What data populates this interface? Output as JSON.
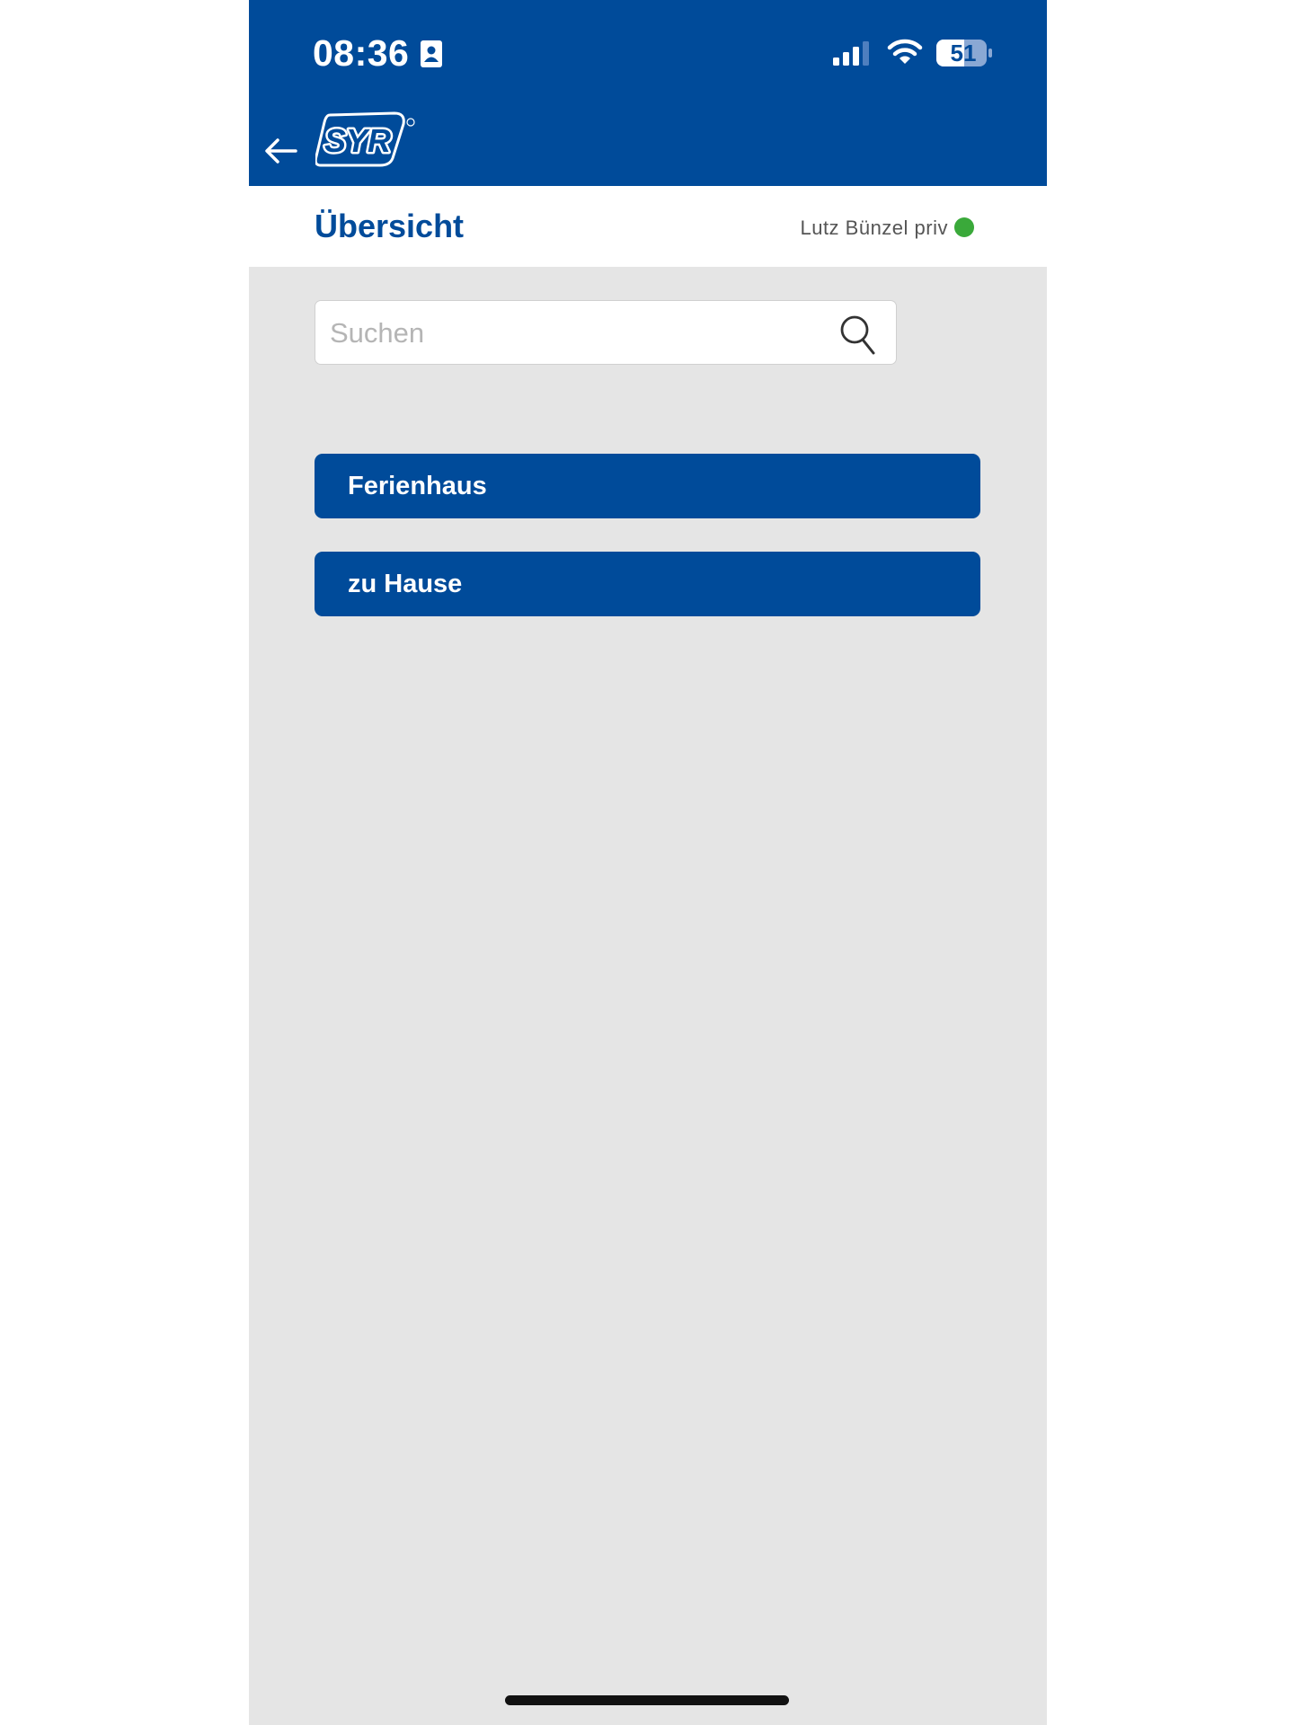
{
  "status_bar": {
    "time": "08:36",
    "battery_level": "51",
    "icons": [
      "contact-card-icon",
      "cellular-signal-icon",
      "wifi-icon",
      "battery-icon"
    ]
  },
  "header": {
    "back_icon": "back-arrow-icon",
    "logo_text": "SYR"
  },
  "subheader": {
    "title": "Übersicht",
    "user_name": "Lutz Bünzel priv",
    "status": "online",
    "status_color": "#3aa93a"
  },
  "search": {
    "placeholder": "Suchen",
    "value": "",
    "icon": "search-icon"
  },
  "groups": [
    {
      "label": "Ferienhaus"
    },
    {
      "label": "zu Hause"
    }
  ],
  "colors": {
    "brand_blue": "#004b9a",
    "background": "#e5e5e5"
  }
}
